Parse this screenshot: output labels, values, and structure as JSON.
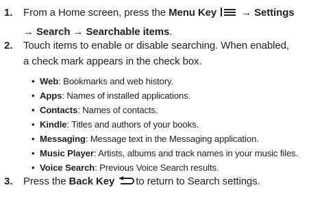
{
  "step1": {
    "num": "1.",
    "pre": "From a Home screen, press the ",
    "menu_key": "Menu Key",
    "arrow1": "→",
    "settings": "Settings",
    "arrow2": "→",
    "search": "Search",
    "arrow3": "→",
    "searchable_items": "Searchable items",
    "end": "."
  },
  "step2": {
    "num": "2.",
    "line1": "Touch items to enable or disable searching. When enabled,",
    "line2": "a check mark appears in the check box.",
    "items": [
      {
        "term": "Web",
        "desc": ": Bookmarks and web history."
      },
      {
        "term": "Apps",
        "desc": ": Names of installed applications."
      },
      {
        "term": "Contacts",
        "desc": ": Names of contacts."
      },
      {
        "term": "Kindle",
        "desc": ": Titles and authors of your books."
      },
      {
        "term": "Messaging",
        "desc": ":  Message text in the Messaging application."
      },
      {
        "term": "Music Player",
        "desc": ": Artists, albums and track names in your music files."
      },
      {
        "term": "Voice Search",
        "desc": ": Previous Voice Search results."
      }
    ]
  },
  "step3": {
    "num": "3.",
    "pre": "Press the ",
    "back_key": "Back Key",
    "post": "to return to Search settings."
  },
  "icons": {
    "menu": "menu-key-icon",
    "back": "back-key-icon",
    "bullet": "•"
  }
}
